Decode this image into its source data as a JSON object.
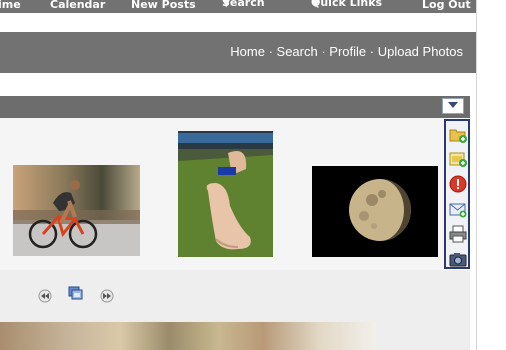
{
  "topnav": {
    "items": [
      "ime",
      "Calendar",
      "New Posts",
      "Search",
      "Quick Links",
      "Log Out"
    ]
  },
  "header": {
    "links": [
      "Home",
      "Search",
      "Profile",
      "Upload Photos"
    ],
    "separator": " · "
  },
  "gallery": {
    "thumbnails": [
      "cyclist-photo",
      "giant-foot-sculpture-photo",
      "moon-photo"
    ]
  },
  "toolbar": {
    "icons": [
      "add-folder-icon",
      "add-photo-icon",
      "report-icon",
      "email-icon",
      "print-icon",
      "camera-icon"
    ]
  },
  "colors": {
    "nav_bg": "#727272",
    "toolbar_border": "#283a6e"
  }
}
